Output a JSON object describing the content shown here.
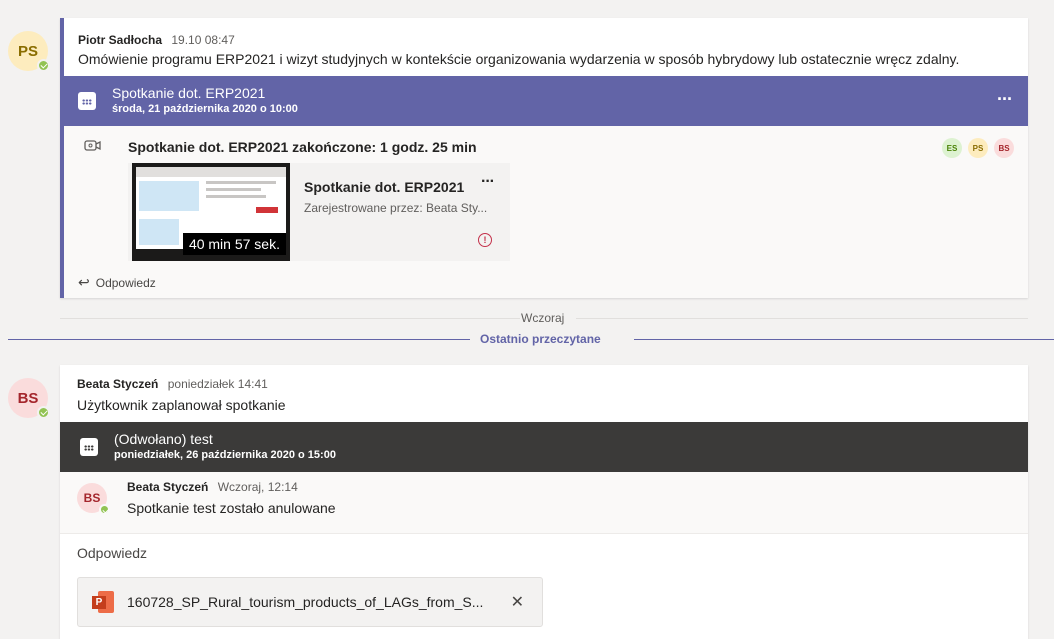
{
  "post1": {
    "avatar_initials": "PS",
    "author": "Piotr Sadłocha",
    "time": "19.10 08:47",
    "text": "Omówienie programu ERP2021 i wizyt studyjnych w kontekście organizowania wydarzenia w sposób hybrydowy lub ostatecznie wręcz zdalny.",
    "meeting": {
      "title": "Spotkanie dot. ERP2021",
      "date": "środa, 21 października 2020 o 10:00",
      "more": "···",
      "color": "#6264a7"
    },
    "ended": {
      "text": "Spotkanie dot. ERP2021 zakończone: 1 godz. 25 min",
      "participants": [
        "ES",
        "PS",
        "BS"
      ]
    },
    "recording": {
      "title": "Spotkanie dot. ERP2021",
      "subtitle": "Zarejestrowane przez: Beata Sty...",
      "duration": "40 min 57 sek.",
      "more": "···"
    },
    "reply": "Odpowiedz"
  },
  "separator": {
    "day": "Wczoraj",
    "last_read": "Ostatnio przeczytane",
    "accent": "#6264a7"
  },
  "post2": {
    "avatar_initials": "BS",
    "author": "Beata Styczeń",
    "time": "poniedziałek 14:41",
    "text": "Użytkownik zaplanował spotkanie",
    "meeting": {
      "title": "(Odwołano) test",
      "date": "poniedziałek, 26 października 2020 o 15:00",
      "color": "#3b3a39"
    },
    "reply_item": {
      "avatar_initials": "BS",
      "author": "Beata Styczeń",
      "time": "Wczoraj, 12:14",
      "text": "Spotkanie test zostało anulowane"
    },
    "reply_prompt": "Odpowiedz",
    "attachment": {
      "filename": "160728_SP_Rural_tourism_products_of_LAGs_from_S...",
      "icon": "powerpoint-icon"
    }
  }
}
